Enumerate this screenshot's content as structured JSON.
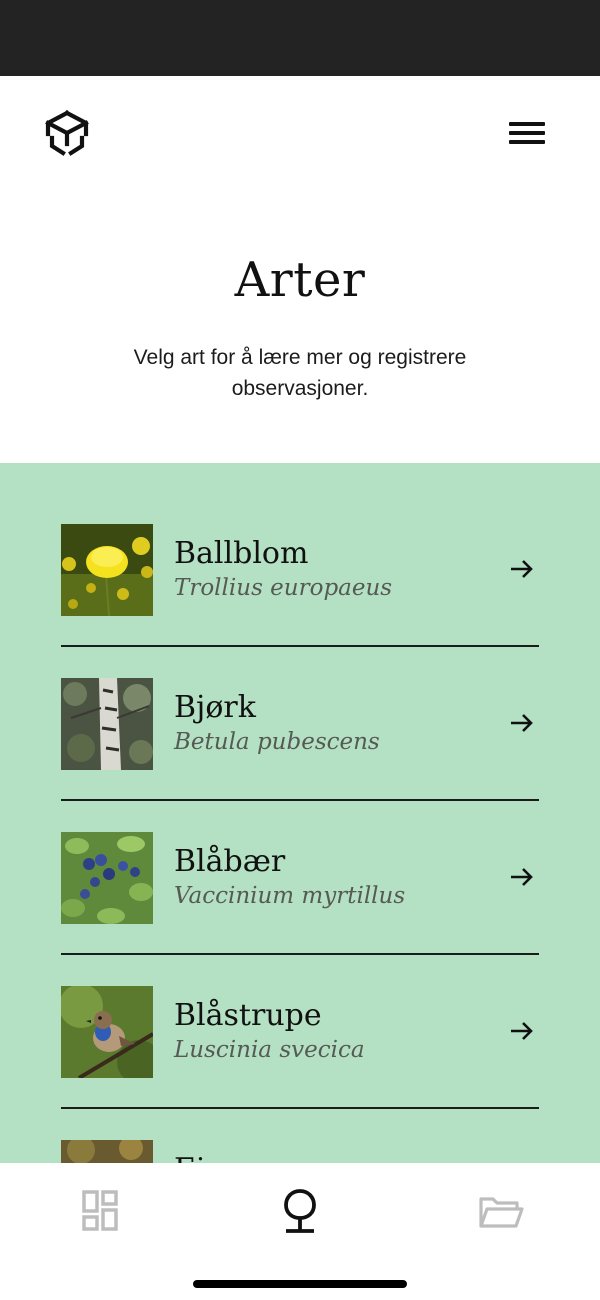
{
  "header": {
    "logo_icon": "hexagon-logo-icon",
    "menu_icon": "hamburger-menu-icon"
  },
  "page": {
    "title": "Arter",
    "subtitle": "Velg art for å lære mer og registrere observasjoner."
  },
  "colors": {
    "status_bar": "#232323",
    "panel_background": "#b4e0c4",
    "latin_name_text": "#555a55",
    "inactive_nav_icon": "#bdbdbd"
  },
  "species": [
    {
      "name": "Ballblom",
      "latin": "Trollius europaeus",
      "thumb_icon": "yellow-flower-photo"
    },
    {
      "name": "Bjørk",
      "latin": "Betula pubescens",
      "thumb_icon": "birch-tree-photo"
    },
    {
      "name": "Blåbær",
      "latin": "Vaccinium myrtillus",
      "thumb_icon": "blueberry-photo"
    },
    {
      "name": "Blåstrupe",
      "latin": "Luscinia svecica",
      "thumb_icon": "bluethroat-bird-photo"
    },
    {
      "name": "Einerr",
      "latin": "",
      "thumb_icon": "partial-photo"
    }
  ],
  "bottom_nav": {
    "items": [
      {
        "icon": "grid-dashboard-icon",
        "active": false
      },
      {
        "icon": "tree-icon",
        "active": true
      },
      {
        "icon": "folder-open-icon",
        "active": false
      }
    ]
  }
}
